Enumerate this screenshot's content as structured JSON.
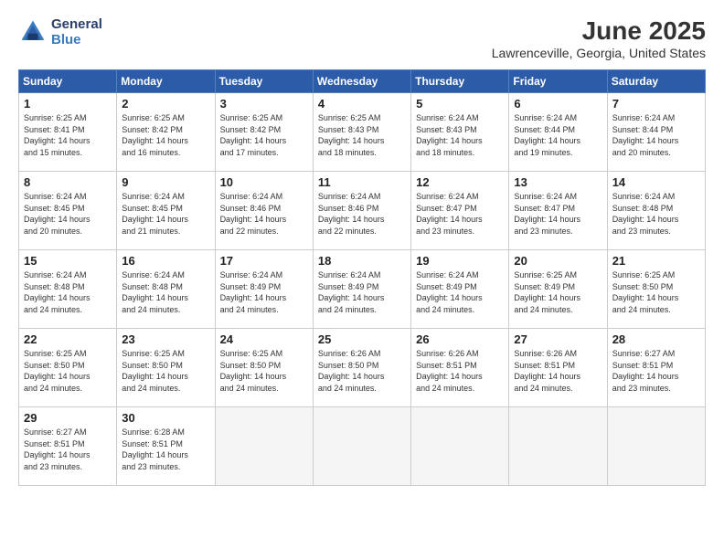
{
  "header": {
    "logo_general": "General",
    "logo_blue": "Blue",
    "month": "June 2025",
    "location": "Lawrenceville, Georgia, United States"
  },
  "weekdays": [
    "Sunday",
    "Monday",
    "Tuesday",
    "Wednesday",
    "Thursday",
    "Friday",
    "Saturday"
  ],
  "weeks": [
    [
      {
        "day": "1",
        "lines": [
          "Sunrise: 6:25 AM",
          "Sunset: 8:41 PM",
          "Daylight: 14 hours",
          "and 15 minutes."
        ]
      },
      {
        "day": "2",
        "lines": [
          "Sunrise: 6:25 AM",
          "Sunset: 8:42 PM",
          "Daylight: 14 hours",
          "and 16 minutes."
        ]
      },
      {
        "day": "3",
        "lines": [
          "Sunrise: 6:25 AM",
          "Sunset: 8:42 PM",
          "Daylight: 14 hours",
          "and 17 minutes."
        ]
      },
      {
        "day": "4",
        "lines": [
          "Sunrise: 6:25 AM",
          "Sunset: 8:43 PM",
          "Daylight: 14 hours",
          "and 18 minutes."
        ]
      },
      {
        "day": "5",
        "lines": [
          "Sunrise: 6:24 AM",
          "Sunset: 8:43 PM",
          "Daylight: 14 hours",
          "and 18 minutes."
        ]
      },
      {
        "day": "6",
        "lines": [
          "Sunrise: 6:24 AM",
          "Sunset: 8:44 PM",
          "Daylight: 14 hours",
          "and 19 minutes."
        ]
      },
      {
        "day": "7",
        "lines": [
          "Sunrise: 6:24 AM",
          "Sunset: 8:44 PM",
          "Daylight: 14 hours",
          "and 20 minutes."
        ]
      }
    ],
    [
      {
        "day": "8",
        "lines": [
          "Sunrise: 6:24 AM",
          "Sunset: 8:45 PM",
          "Daylight: 14 hours",
          "and 20 minutes."
        ]
      },
      {
        "day": "9",
        "lines": [
          "Sunrise: 6:24 AM",
          "Sunset: 8:45 PM",
          "Daylight: 14 hours",
          "and 21 minutes."
        ]
      },
      {
        "day": "10",
        "lines": [
          "Sunrise: 6:24 AM",
          "Sunset: 8:46 PM",
          "Daylight: 14 hours",
          "and 22 minutes."
        ]
      },
      {
        "day": "11",
        "lines": [
          "Sunrise: 6:24 AM",
          "Sunset: 8:46 PM",
          "Daylight: 14 hours",
          "and 22 minutes."
        ]
      },
      {
        "day": "12",
        "lines": [
          "Sunrise: 6:24 AM",
          "Sunset: 8:47 PM",
          "Daylight: 14 hours",
          "and 23 minutes."
        ]
      },
      {
        "day": "13",
        "lines": [
          "Sunrise: 6:24 AM",
          "Sunset: 8:47 PM",
          "Daylight: 14 hours",
          "and 23 minutes."
        ]
      },
      {
        "day": "14",
        "lines": [
          "Sunrise: 6:24 AM",
          "Sunset: 8:48 PM",
          "Daylight: 14 hours",
          "and 23 minutes."
        ]
      }
    ],
    [
      {
        "day": "15",
        "lines": [
          "Sunrise: 6:24 AM",
          "Sunset: 8:48 PM",
          "Daylight: 14 hours",
          "and 24 minutes."
        ]
      },
      {
        "day": "16",
        "lines": [
          "Sunrise: 6:24 AM",
          "Sunset: 8:48 PM",
          "Daylight: 14 hours",
          "and 24 minutes."
        ]
      },
      {
        "day": "17",
        "lines": [
          "Sunrise: 6:24 AM",
          "Sunset: 8:49 PM",
          "Daylight: 14 hours",
          "and 24 minutes."
        ]
      },
      {
        "day": "18",
        "lines": [
          "Sunrise: 6:24 AM",
          "Sunset: 8:49 PM",
          "Daylight: 14 hours",
          "and 24 minutes."
        ]
      },
      {
        "day": "19",
        "lines": [
          "Sunrise: 6:24 AM",
          "Sunset: 8:49 PM",
          "Daylight: 14 hours",
          "and 24 minutes."
        ]
      },
      {
        "day": "20",
        "lines": [
          "Sunrise: 6:25 AM",
          "Sunset: 8:49 PM",
          "Daylight: 14 hours",
          "and 24 minutes."
        ]
      },
      {
        "day": "21",
        "lines": [
          "Sunrise: 6:25 AM",
          "Sunset: 8:50 PM",
          "Daylight: 14 hours",
          "and 24 minutes."
        ]
      }
    ],
    [
      {
        "day": "22",
        "lines": [
          "Sunrise: 6:25 AM",
          "Sunset: 8:50 PM",
          "Daylight: 14 hours",
          "and 24 minutes."
        ]
      },
      {
        "day": "23",
        "lines": [
          "Sunrise: 6:25 AM",
          "Sunset: 8:50 PM",
          "Daylight: 14 hours",
          "and 24 minutes."
        ]
      },
      {
        "day": "24",
        "lines": [
          "Sunrise: 6:25 AM",
          "Sunset: 8:50 PM",
          "Daylight: 14 hours",
          "and 24 minutes."
        ]
      },
      {
        "day": "25",
        "lines": [
          "Sunrise: 6:26 AM",
          "Sunset: 8:50 PM",
          "Daylight: 14 hours",
          "and 24 minutes."
        ]
      },
      {
        "day": "26",
        "lines": [
          "Sunrise: 6:26 AM",
          "Sunset: 8:51 PM",
          "Daylight: 14 hours",
          "and 24 minutes."
        ]
      },
      {
        "day": "27",
        "lines": [
          "Sunrise: 6:26 AM",
          "Sunset: 8:51 PM",
          "Daylight: 14 hours",
          "and 24 minutes."
        ]
      },
      {
        "day": "28",
        "lines": [
          "Sunrise: 6:27 AM",
          "Sunset: 8:51 PM",
          "Daylight: 14 hours",
          "and 23 minutes."
        ]
      }
    ],
    [
      {
        "day": "29",
        "lines": [
          "Sunrise: 6:27 AM",
          "Sunset: 8:51 PM",
          "Daylight: 14 hours",
          "and 23 minutes."
        ]
      },
      {
        "day": "30",
        "lines": [
          "Sunrise: 6:28 AM",
          "Sunset: 8:51 PM",
          "Daylight: 14 hours",
          "and 23 minutes."
        ]
      },
      null,
      null,
      null,
      null,
      null
    ]
  ]
}
